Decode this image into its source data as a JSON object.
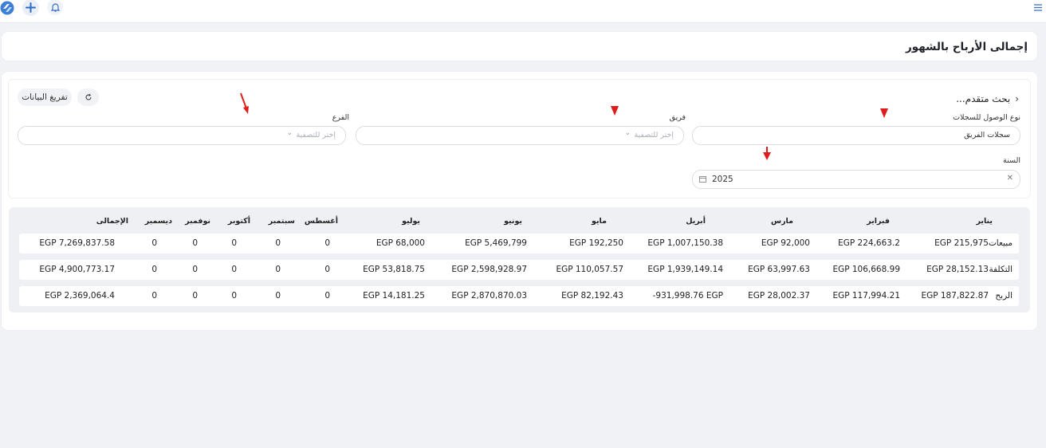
{
  "topbar": {
    "logo_icon": "logo-icon",
    "add_icon": "plus-icon",
    "notifications_icon": "bell-icon",
    "menu_icon": "hamburger-icon"
  },
  "page": {
    "title": "إجمالى الأرباح بالشهور"
  },
  "filters": {
    "advanced_search": "بحث متقدم...",
    "export_label": "تفريغ البيانات",
    "refresh_icon": "refresh-icon",
    "access_type": {
      "label": "نوع الوصول للسجلات",
      "value": "سجلات الفريق"
    },
    "team": {
      "label": "فريق",
      "placeholder": "إختر للتصفية"
    },
    "branch": {
      "label": "الفرع",
      "placeholder": "إختر للتصفية"
    },
    "year": {
      "label": "السنة",
      "value": "2025"
    }
  },
  "table": {
    "headers": [
      "يناير",
      "فبراير",
      "مارس",
      "أبريل",
      "مايو",
      "يونيو",
      "يوليو",
      "أغسطس",
      "سبتمبر",
      "أكتوبر",
      "نوفمبر",
      "ديسمبر",
      "الإجمالى"
    ],
    "rows": [
      {
        "label": "مبيعات",
        "cells": [
          "EGP 215,975",
          "EGP 224,663.2",
          "EGP 92,000",
          "EGP 1,007,150.38",
          "EGP 192,250",
          "EGP 5,469,799",
          "EGP 68,000",
          "0",
          "0",
          "0",
          "0",
          "0",
          "EGP 7,269,837.58"
        ]
      },
      {
        "label": "التكلفة",
        "cells": [
          "EGP 28,152.13",
          "EGP 106,668.99",
          "EGP 63,997.63",
          "EGP 1,939,149.14",
          "EGP 110,057.57",
          "EGP 2,598,928.97",
          "EGP 53,818.75",
          "0",
          "0",
          "0",
          "0",
          "0",
          "EGP 4,900,773.17"
        ]
      },
      {
        "label": "الربح",
        "cells": [
          "EGP 187,822.87",
          "EGP 117,994.21",
          "EGP 28,002.37",
          "-931,998.76 EGP",
          "EGP 82,192.43",
          "EGP 2,870,870.03",
          "EGP 14,181.25",
          "0",
          "0",
          "0",
          "0",
          "0",
          "EGP 2,369,064.4"
        ]
      }
    ]
  }
}
